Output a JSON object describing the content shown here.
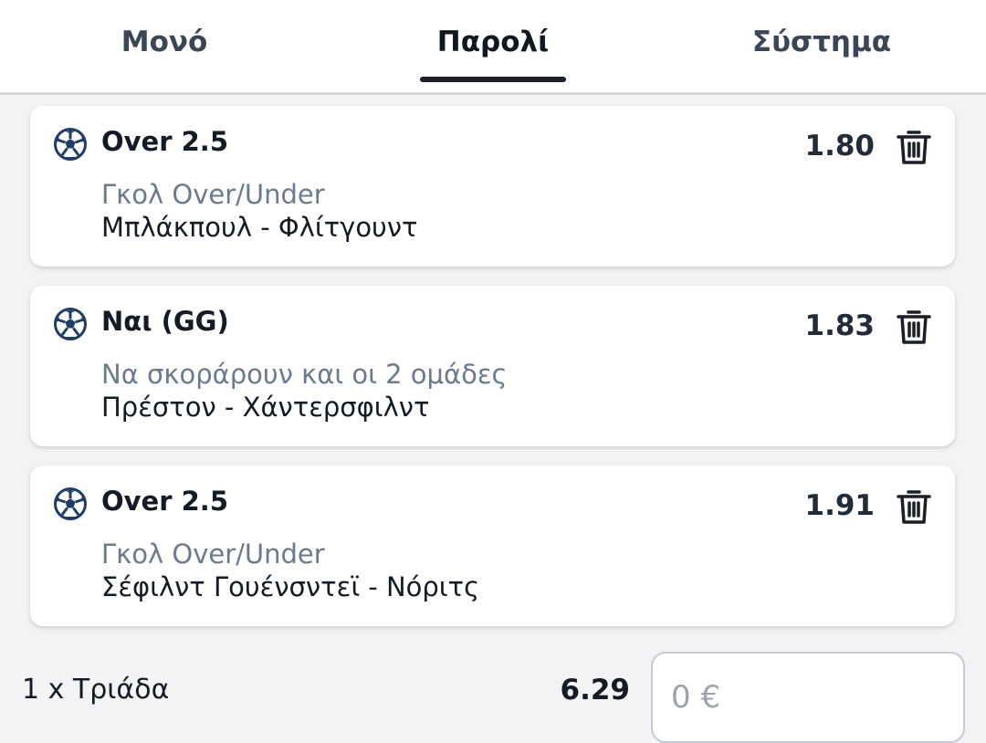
{
  "tabs": [
    {
      "label": "Μονό"
    },
    {
      "label": "Παρολί"
    },
    {
      "label": "Σύστημα"
    }
  ],
  "active_tab": "Παρολί",
  "icons": {
    "sport": "soccer-ball-icon",
    "remove": "trash-icon"
  },
  "colors": {
    "ball": "#1f3d66",
    "market_text": "#6b7a8e",
    "tab_underline": "#1b1f27"
  },
  "bets": [
    {
      "selection": "Over 2.5",
      "market": "Γκολ Over/Under",
      "match": "Μπλάκπουλ - Φλίτγουντ",
      "odd": "1.80"
    },
    {
      "selection": "Ναι (GG)",
      "market": "Να σκοράρουν και οι 2 ομάδες",
      "match": "Πρέστον - Χάντερσφιλντ",
      "odd": "1.83"
    },
    {
      "selection": "Over 2.5",
      "market": "Γκολ Over/Under",
      "match": "Σέφιλντ Γουένσντεϊ - Νόριτς",
      "odd": "1.91"
    }
  ],
  "summary": {
    "label": "1 x Τριάδα",
    "total_odd": "6.29",
    "stake_placeholder": "0 €"
  }
}
